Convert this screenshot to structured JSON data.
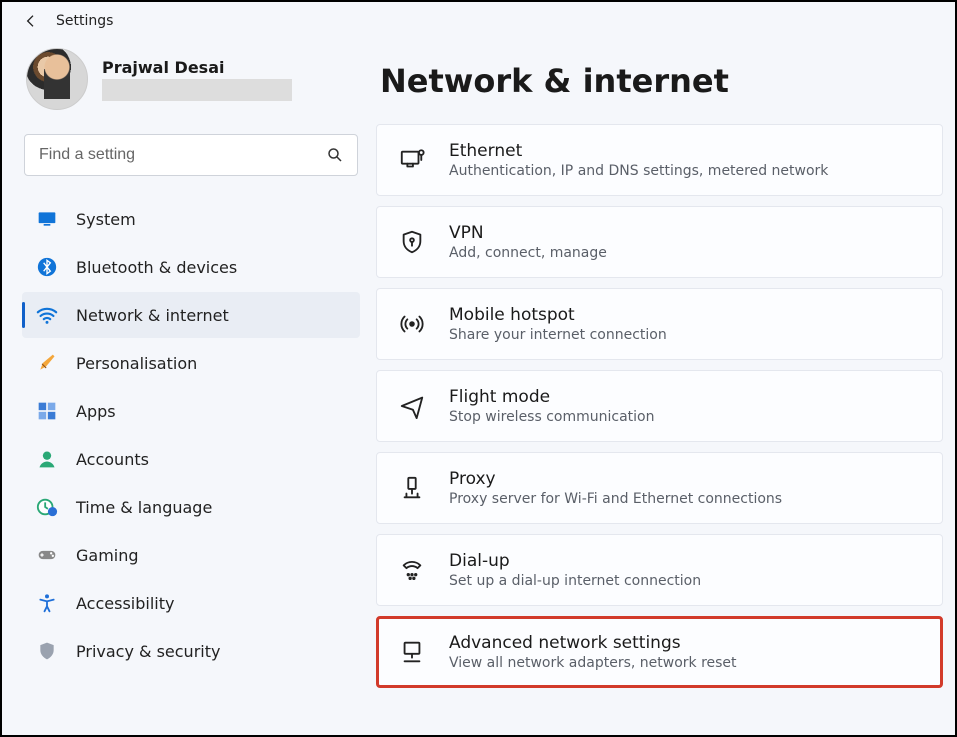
{
  "header": {
    "title": "Settings"
  },
  "user": {
    "name": "Prajwal Desai"
  },
  "search": {
    "placeholder": "Find a setting"
  },
  "sidebar": {
    "items": [
      {
        "id": "system",
        "label": "System",
        "icon": "monitor",
        "active": false
      },
      {
        "id": "bluetooth",
        "label": "Bluetooth & devices",
        "icon": "bluetooth",
        "active": false
      },
      {
        "id": "network",
        "label": "Network & internet",
        "icon": "wifi",
        "active": true
      },
      {
        "id": "personalisation",
        "label": "Personalisation",
        "icon": "brush",
        "active": false
      },
      {
        "id": "apps",
        "label": "Apps",
        "icon": "apps",
        "active": false
      },
      {
        "id": "accounts",
        "label": "Accounts",
        "icon": "person",
        "active": false
      },
      {
        "id": "time",
        "label": "Time & language",
        "icon": "clock-globe",
        "active": false
      },
      {
        "id": "gaming",
        "label": "Gaming",
        "icon": "gamepad",
        "active": false
      },
      {
        "id": "accessibility",
        "label": "Accessibility",
        "icon": "accessibility",
        "active": false
      },
      {
        "id": "privacy",
        "label": "Privacy & security",
        "icon": "shield",
        "active": false
      }
    ]
  },
  "main": {
    "title": "Network & internet",
    "cards": [
      {
        "id": "ethernet",
        "icon": "ethernet",
        "title": "Ethernet",
        "subtitle": "Authentication, IP and DNS settings, metered network",
        "highlight": false
      },
      {
        "id": "vpn",
        "icon": "shield-key",
        "title": "VPN",
        "subtitle": "Add, connect, manage",
        "highlight": false
      },
      {
        "id": "hotspot",
        "icon": "hotspot",
        "title": "Mobile hotspot",
        "subtitle": "Share your internet connection",
        "highlight": false
      },
      {
        "id": "flight",
        "icon": "plane",
        "title": "Flight mode",
        "subtitle": "Stop wireless communication",
        "highlight": false
      },
      {
        "id": "proxy",
        "icon": "proxy",
        "title": "Proxy",
        "subtitle": "Proxy server for Wi-Fi and Ethernet connections",
        "highlight": false
      },
      {
        "id": "dialup",
        "icon": "dialup",
        "title": "Dial-up",
        "subtitle": "Set up a dial-up internet connection",
        "highlight": false
      },
      {
        "id": "advanced",
        "icon": "adv-net",
        "title": "Advanced network settings",
        "subtitle": "View all network adapters, network reset",
        "highlight": true
      }
    ]
  }
}
